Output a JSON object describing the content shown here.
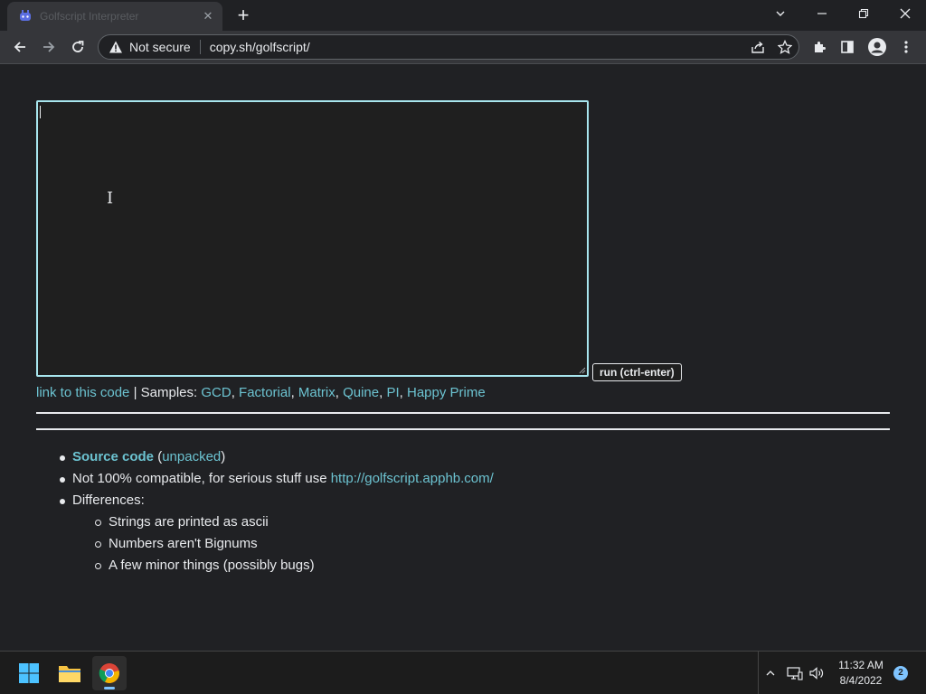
{
  "browser": {
    "tab_title": "Golfscript Interpreter",
    "security_label": "Not secure",
    "url": "copy.sh/golfscript/"
  },
  "page": {
    "run_label": "run (ctrl-enter)",
    "link_label": "link to this code",
    "separator": "|",
    "samples_label": "Samples:",
    "samples": [
      "GCD",
      "Factorial",
      "Matrix",
      "Quine",
      "PI",
      "Happy Prime"
    ],
    "comma": ",",
    "notes": {
      "source_code": "Source code",
      "unpacked_open": "(",
      "unpacked": "unpacked",
      "unpacked_close": ")",
      "compat_text": "Not 100% compatible, for serious stuff use",
      "compat_link": "http://golfscript.apphb.com/",
      "differences": "Differences:",
      "diff_items": [
        "Strings are printed as ascii",
        "Numbers aren't Bignums",
        "A few minor things (possibly bugs)"
      ]
    }
  },
  "taskbar": {
    "time": "11:32 AM",
    "date": "8/4/2022",
    "notification_count": "2"
  },
  "colors": {
    "background": "#202124",
    "link": "#6cc3d1",
    "editor_border": "#a8e6ee",
    "text": "#e8eaed"
  }
}
